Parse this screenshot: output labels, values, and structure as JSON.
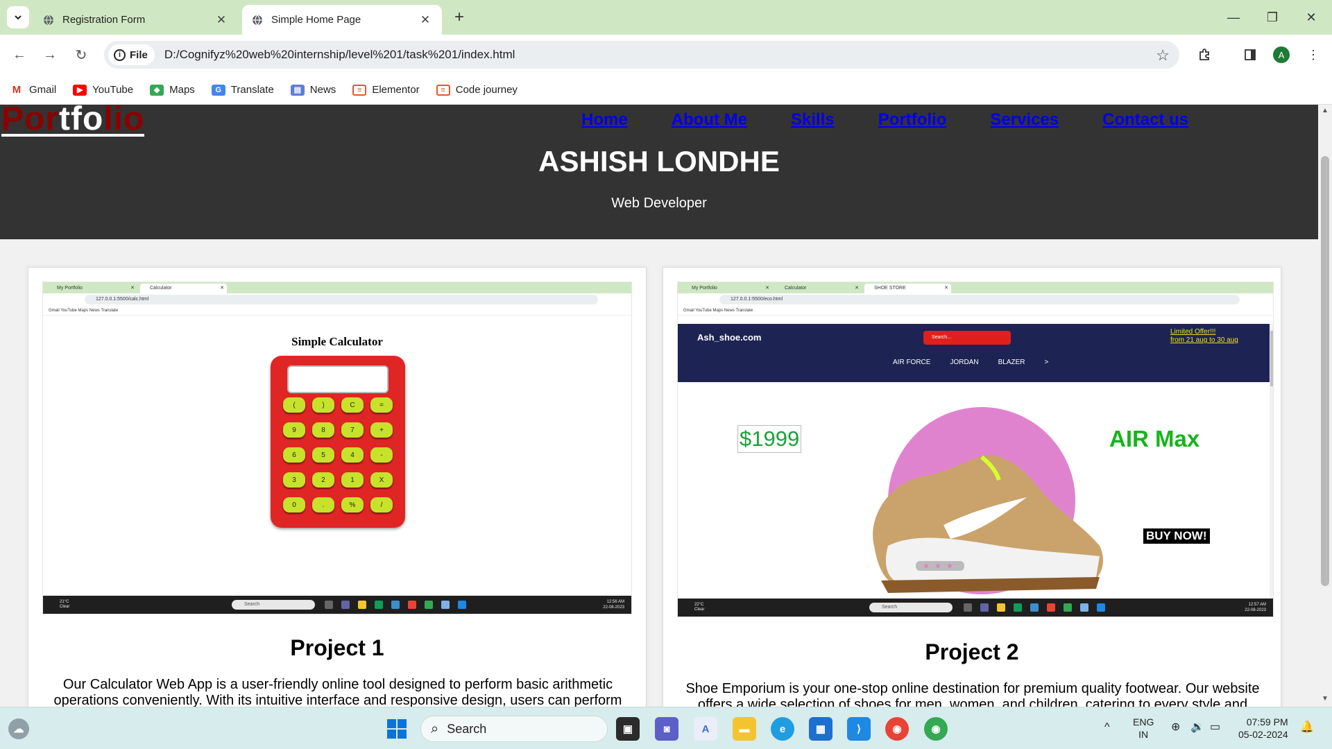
{
  "browser": {
    "tabs": [
      {
        "title": "Registration Form",
        "active": false
      },
      {
        "title": "Simple Home Page",
        "active": true
      }
    ],
    "omnibox": {
      "chip_label": "File",
      "url": "D:/Cognifyz%20web%20internship/level%201/task%201/index.html"
    },
    "profile_initial": "A",
    "bookmarks": [
      "Gmail",
      "YouTube",
      "Maps",
      "Translate",
      "News",
      "Elementor",
      "Code journey"
    ]
  },
  "page": {
    "logo": {
      "part1": "Por",
      "part2": "tfo",
      "part3": "lio"
    },
    "nav": [
      "Home",
      "About Me",
      "Skills",
      "Portfolio",
      "Services",
      "Contact us"
    ],
    "name": "ASHISH LONDHE",
    "role": "Web Developer",
    "projects": [
      {
        "title": "Project 1",
        "description": "Our Calculator Web App is a user-friendly online tool designed to perform basic arithmetic operations conveniently. With its intuitive interface and responsive design, users can perform",
        "screenshot": {
          "tabs": [
            "My Portfolio",
            "Calculator"
          ],
          "url": "127.0.0.1:5500/calc.html",
          "bookmarks": "Gmail   YouTube   Maps   News   Translate",
          "heading": "Simple Calculator",
          "keys": [
            "(",
            ")",
            "C",
            "=",
            "9",
            "8",
            "7",
            "+",
            "6",
            "5",
            "4",
            "-",
            "3",
            "2",
            "1",
            "X",
            "0",
            ".",
            "%",
            "/"
          ],
          "taskbar": {
            "search": "Search",
            "weather": "21°C\nClear",
            "clock": "12:56 AM\n22-08-2023"
          }
        }
      },
      {
        "title": "Project 2",
        "description": "Shoe Emporium is your one-stop online destination for premium quality footwear. Our website offers a wide selection of shoes for men, women, and children, catering to every style and",
        "screenshot": {
          "tabs": [
            "My Portfolio",
            "Calculator",
            "SHOE STORE"
          ],
          "url": "127.0.0.1:5500/eco.html",
          "bookmarks": "Gmail   YouTube   Maps   News   Translate",
          "brand": "Ash_shoe.com",
          "search_placeholder": "Search...",
          "offer_line1": "Limited Offer!!!",
          "offer_line2": "from 21 aug to 30 aug",
          "links": [
            "AIR FORCE",
            "JORDAN",
            "BLAZER",
            ">"
          ],
          "price": "$1999",
          "product": "AIR Max",
          "cta": "BUY NOW!",
          "taskbar": {
            "search": "Search",
            "weather": "22°C\nClear",
            "clock": "12:57 AM\n22-08-2023"
          }
        }
      }
    ]
  },
  "taskbar": {
    "search_label": "Search",
    "language": "ENG",
    "region": "IN",
    "time": "07:59 PM",
    "date": "05-02-2024"
  },
  "colors": {
    "header_bg": "#333333",
    "nav_link": "#0000ee",
    "logo_red": "#8b0000",
    "tabstrip": "#cfe8c3"
  }
}
